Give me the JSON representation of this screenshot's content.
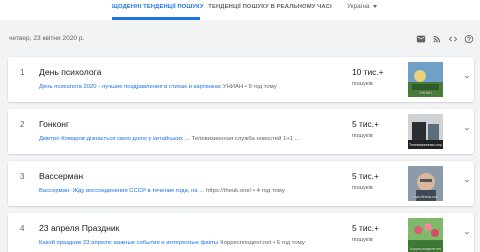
{
  "header": {
    "tab_daily": "ЩОДЕННІ ТЕНДЕНЦІЇ ПОШУКУ",
    "tab_realtime": "ТЕНДЕНЦІЇ ПОШУКУ В РЕАЛЬНОМУ ЧАСІ",
    "region": "Україна"
  },
  "date": "четвер, 23 квітня 2020 р.",
  "toolbar_icons": [
    "email-icon",
    "rss-icon",
    "embed-icon",
    "help-icon"
  ],
  "trends": [
    {
      "rank": "1",
      "title": "День психолога",
      "article": "День психолога 2020 - лучшие поздравления в стихах и картинках",
      "source": "УНИАН • 9 год тому",
      "count": "10 тис.+",
      "count_label": "пошуків",
      "thumb_caption": "УНИАН"
    },
    {
      "rank": "2",
      "title": "Гонконг",
      "article": "Дмитро Комаров дізнається свою долю у китайських ...",
      "source": "Телевизионная служба новостей 1+1 ...",
      "count": "5 тис.+",
      "count_label": "пошуків",
      "thumb_caption": "Телевизионная служба новостей 1+1"
    },
    {
      "rank": "3",
      "title": "Вассерман",
      "article": "Вассерман: Жду воссоединения СССР в течение года, на ...",
      "source": "https://theuk.one/ • 4 год тому",
      "count": "5 тис.+",
      "count_label": "пошуків",
      "thumb_caption": "https://theuk.one/"
    },
    {
      "rank": "4",
      "title": "23 апреля Праздник",
      "article": "Какой праздник 23 апреля: важные события и интересные факты",
      "source": "Корреспондент.net • 6 год тому",
      "count": "5 тис.+",
      "count_label": "пошуків",
      "thumb_caption": "Корреспондент.net"
    }
  ],
  "colors": {
    "accent": "#1a73e8",
    "background": "#f1f3f4",
    "muted": "#5f6368"
  }
}
